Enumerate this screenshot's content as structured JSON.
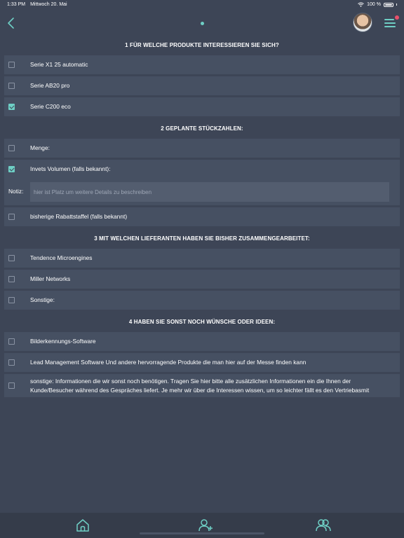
{
  "status_bar": {
    "time": "1:33 PM",
    "date": "Mittwoch 20. Mai",
    "battery": "100 %"
  },
  "nav": {
    "back_icon": "chevron-left-icon",
    "menu_icon": "menu-icon",
    "accent_color": "#6ecfc5",
    "badge_color": "#e8506a"
  },
  "sections": [
    {
      "title": "1 FÜR WELCHE PRODUKTE INTERESSIEREN SIE SICH?",
      "items": [
        {
          "label": "Serie X1 25 automatic",
          "checked": false
        },
        {
          "label": "Serie AB20 pro",
          "checked": false
        },
        {
          "label": "Serie C200 eco",
          "checked": true
        }
      ]
    },
    {
      "title": "2 GEPLANTE STÜCKZAHLEN:",
      "items": [
        {
          "label": "Menge:",
          "checked": false
        },
        {
          "label": "Invets Volumen (falls bekannt):",
          "checked": true
        },
        {
          "label": "bisherige Rabattstaffel (falls bekannt)",
          "checked": false
        }
      ],
      "note": {
        "label": "Notiz:",
        "placeholder": "hier ist Platz um weitere Details zu beschreiben",
        "value": ""
      }
    },
    {
      "title": "3 MIT WELCHEN LIEFERANTEN HABEN SIE BISHER ZUSAMMENGEARBEITET:",
      "items": [
        {
          "label": "Tendence Microengines",
          "checked": false
        },
        {
          "label": "Miller Networks",
          "checked": false
        },
        {
          "label": "Sonstige:",
          "checked": false
        }
      ]
    },
    {
      "title": "4 HABEN SIE SONST NOCH WÜNSCHE ODER IDEEN:",
      "items": [
        {
          "label": "Bilderkennungs-Software",
          "checked": false
        },
        {
          "label": "Lead Management Software Und andere hervorragende Produkte die man hier auf der Messe finden kann",
          "checked": false
        },
        {
          "label": "sonstige: Informationen die wir sonst noch benötigen. Tragen Sie hier bitte alle zusätzlichen Informationen ein die Ihnen der Kunde/Besucher während des Gespräches liefert. Je mehr wir über die Interessen wissen, um so leichter fällt es den Vertriebasmit",
          "checked": false
        }
      ]
    }
  ],
  "tab_bar": {
    "tabs": [
      {
        "icon": "home-icon"
      },
      {
        "icon": "add-person-icon"
      },
      {
        "icon": "people-icon"
      }
    ]
  }
}
